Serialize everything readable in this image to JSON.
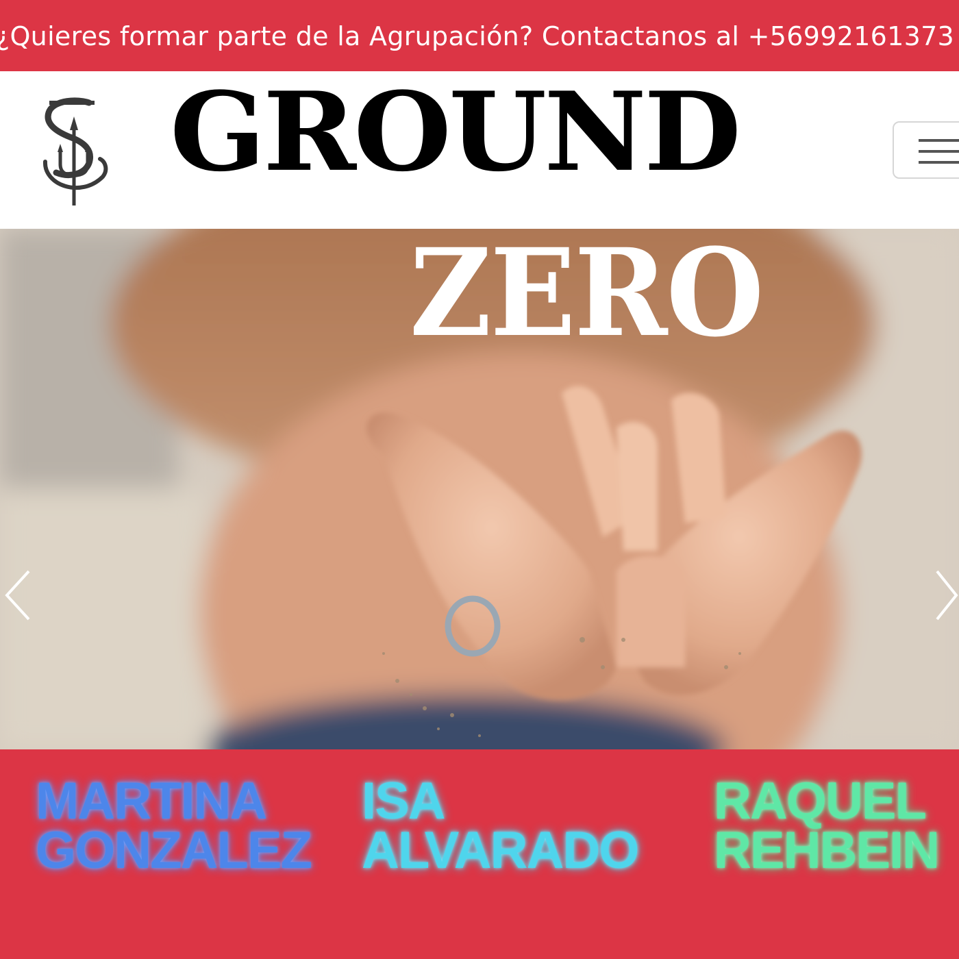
{
  "banner": {
    "text": "¿Quieres formar parte de la Agrupación? Contactanos al +56992161373"
  },
  "navbar": {
    "logo": "trident-logo",
    "menu_icon": "hamburger-menu-icon"
  },
  "title": {
    "word1": "GROUND",
    "word2": "ZERO"
  },
  "hero": {
    "image": "hands-holding-sand-photo",
    "prev_icon": "chevron-left-icon",
    "next_icon": "chevron-right-icon"
  },
  "members": [
    {
      "first": "MARTINA",
      "last": "GONZALEZ",
      "color": "#4d86ea"
    },
    {
      "first": "ISA",
      "last": "ALVARADO",
      "color": "#4fd5ec"
    },
    {
      "first": "RAQUEL",
      "last": "REHBEIN",
      "color": "#5fe7a6"
    }
  ],
  "colors": {
    "brand_red": "#dc3545"
  }
}
